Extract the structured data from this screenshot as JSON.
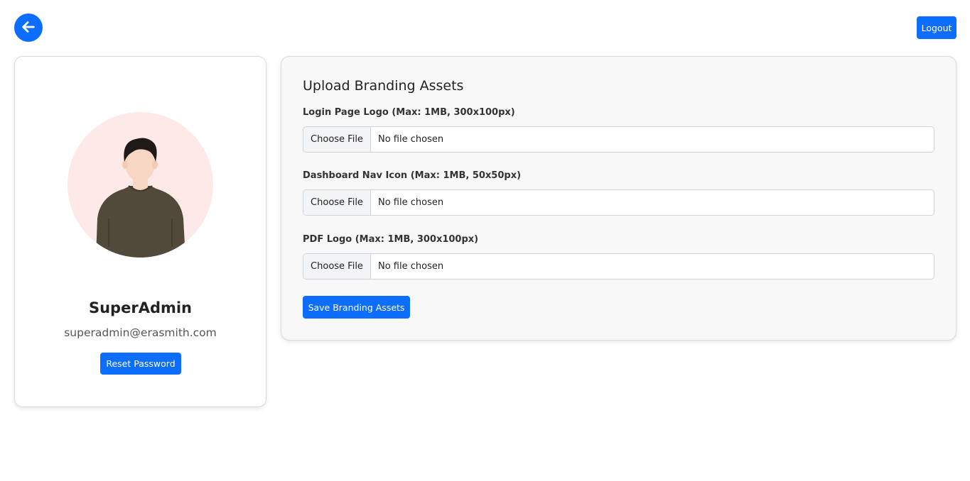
{
  "header": {
    "back_icon": "arrow-left-icon",
    "logout_label": "Logout",
    "accent_color": "#0d6efd"
  },
  "profile": {
    "avatar_icon": "user-avatar-illustration",
    "name": "SuperAdmin",
    "email": "superadmin@erasmith.com",
    "reset_label": "Reset Password"
  },
  "branding": {
    "title": "Upload Branding Assets",
    "fields": [
      {
        "label": "Login Page Logo (Max: 1MB, 300x100px)",
        "button": "Choose File",
        "status": "No file chosen"
      },
      {
        "label": "Dashboard Nav Icon (Max: 1MB, 50x50px)",
        "button": "Choose File",
        "status": "No file chosen"
      },
      {
        "label": "PDF Logo (Max: 1MB, 300x100px)",
        "button": "Choose File",
        "status": "No file chosen"
      }
    ],
    "save_label": "Save Branding Assets"
  }
}
